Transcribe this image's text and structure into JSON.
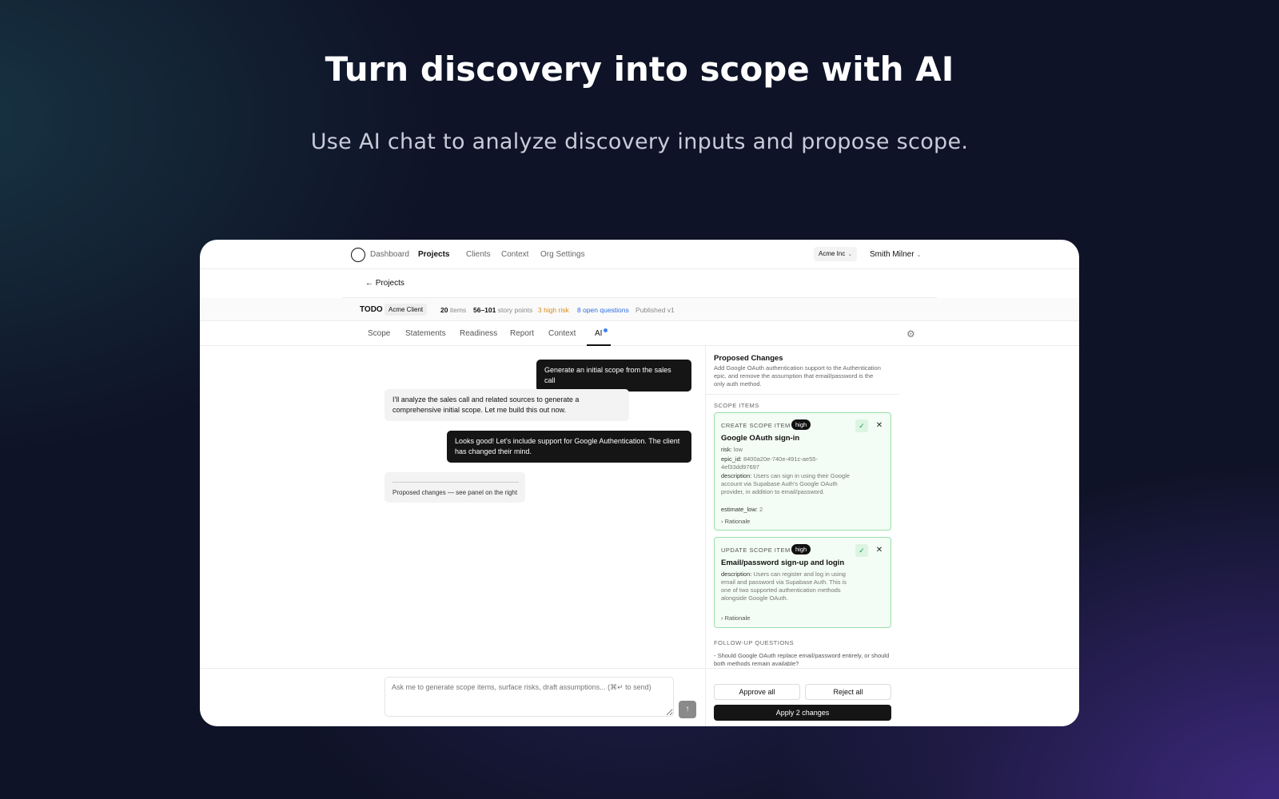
{
  "hero": {
    "title": "Turn discovery into scope with AI",
    "subtitle": "Use AI chat to analyze discovery inputs and propose scope."
  },
  "nav": {
    "items": [
      "Dashboard",
      "Projects",
      "Clients",
      "Context",
      "Org Settings"
    ],
    "active": "Projects",
    "org": "Acme Inc",
    "user": "Smith Milner"
  },
  "back_link": "← Projects",
  "project": {
    "name": "TODO",
    "client": "Acme Client",
    "items_count": "20",
    "items_label": "items",
    "points": "56–101",
    "points_label": "story points",
    "risk": "3 high risk",
    "questions": "8 open questions",
    "published": "Published v1"
  },
  "tabs": {
    "items": [
      "Scope",
      "Statements",
      "Readiness",
      "Report",
      "Context",
      "AI"
    ],
    "active": "AI"
  },
  "chat": {
    "messages": [
      {
        "role": "user",
        "text": "Generate an initial scope from the sales call"
      },
      {
        "role": "assistant",
        "text": "I'll analyze the sales call and related sources to generate a comprehensive initial scope. Let me build this out now."
      },
      {
        "role": "user",
        "text": "Looks good! Let's include support for Google Authentication. The client has changed their mind."
      },
      {
        "role": "assistant",
        "text": "Proposed changes — see panel on the right"
      }
    ],
    "input_placeholder": "Ask me to generate scope items, surface risks, draft assumptions... (⌘↵ to send)"
  },
  "panel": {
    "title": "Proposed Changes",
    "description": "Add Google OAuth authentication support to the Authentication epic, and remove the assumption that email/password is the only auth method.",
    "scope_section": "SCOPE ITEMS",
    "cards": [
      {
        "type": "CREATE SCOPE ITEM",
        "badge": "high",
        "title": "Google OAuth sign-in",
        "fields": [
          {
            "key": "risk:",
            "value": "low"
          },
          {
            "key": "epic_id:",
            "value": "8400a20e-740e-491c-ae55-4ef33dd97697"
          },
          {
            "key": "description:",
            "value": "Users can sign in using their Google account via Supabase Auth's Google OAuth provider, in addition to email/password."
          },
          {
            "key": "estimate_low:",
            "value": "2"
          }
        ],
        "rationale": "Rationale"
      },
      {
        "type": "UPDATE SCOPE ITEM",
        "badge": "high",
        "title": "Email/password sign-up and login",
        "fields": [
          {
            "key": "description:",
            "value": "Users can register and log in using email and password via Supabase Auth. This is one of two supported authentication methods alongside Google OAuth."
          }
        ],
        "rationale": "Rationale"
      }
    ],
    "followup_section": "FOLLOW-UP QUESTIONS",
    "followup_text": "- Should Google OAuth replace email/password entirely, or should both methods remain available?",
    "approve_all": "Approve all",
    "reject_all": "Reject all",
    "apply": "Apply 2 changes"
  },
  "icons": {
    "approve": "check-icon",
    "reject": "close-icon",
    "settings": "gear-icon",
    "send": "arrow-up-icon",
    "logo": "circle-logo",
    "chevron": "chevron-down-icon",
    "rationale": "chevron-right-icon"
  },
  "colors": {
    "risk": "#d98a1c",
    "questions": "#2f6fde",
    "ai_dot": "#3b82f6",
    "card_bg": "#f3fcf5",
    "card_border": "#9be0ad"
  }
}
